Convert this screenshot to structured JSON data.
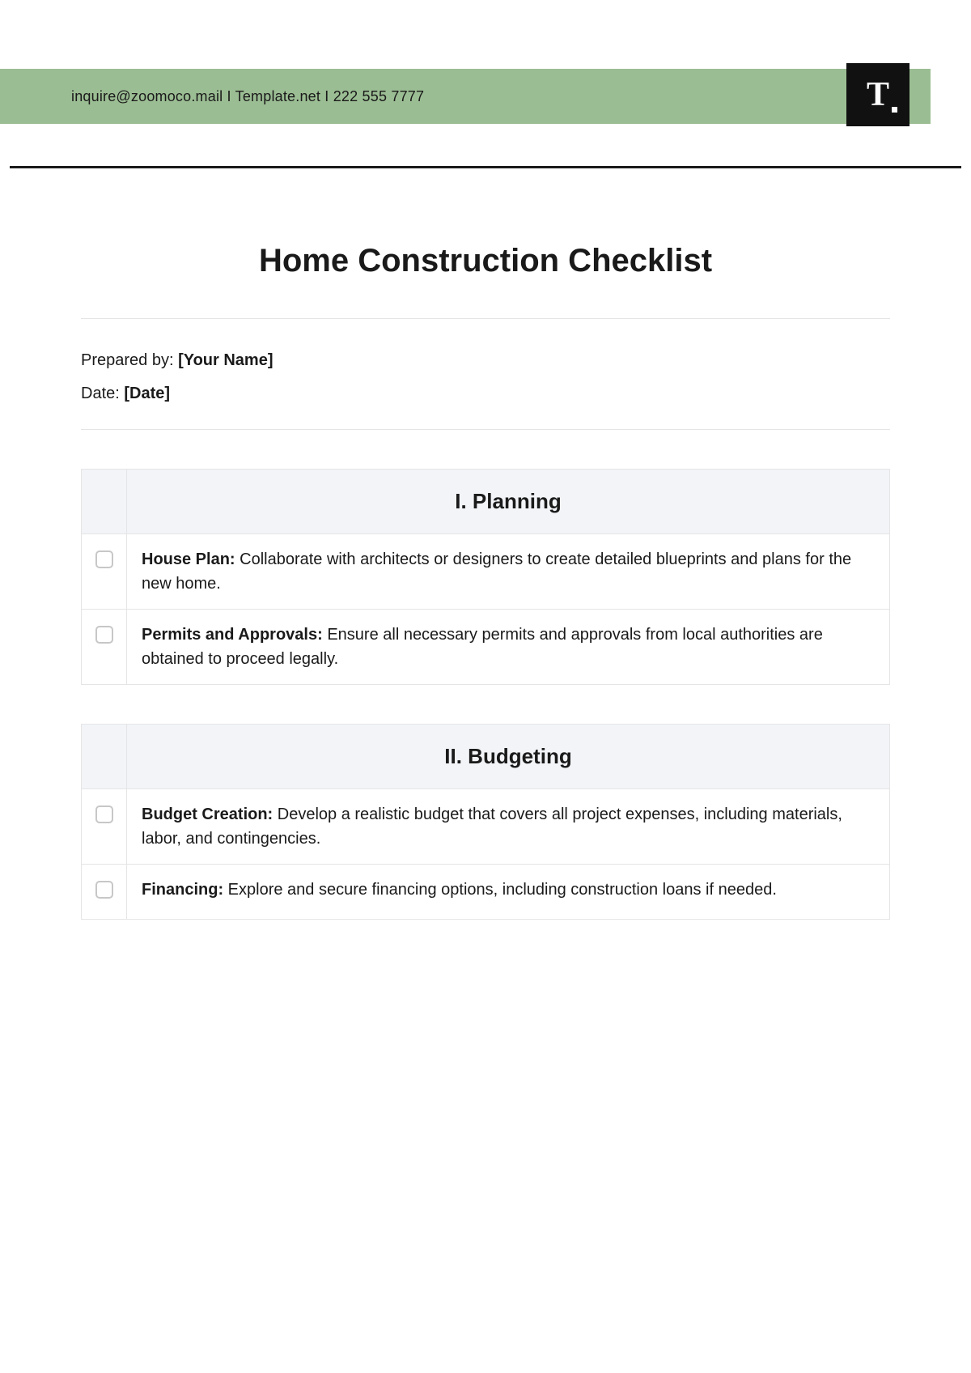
{
  "header": {
    "contact": "inquire@zoomoco.mail  I  Template.net  I  222 555 7777",
    "logo_text": "T"
  },
  "document": {
    "title": "Home Construction Checklist",
    "prepared_by_label": "Prepared by: ",
    "prepared_by_value": "[Your Name]",
    "date_label": "Date: ",
    "date_value": "[Date]"
  },
  "sections": [
    {
      "heading": "I. Planning",
      "items": [
        {
          "label": "House Plan:",
          "text": " Collaborate with architects or designers to create detailed blueprints and plans for the new home."
        },
        {
          "label": "Permits and Approvals:",
          "text": " Ensure all necessary permits and approvals from local authorities are obtained to proceed legally."
        }
      ]
    },
    {
      "heading": "II. Budgeting",
      "items": [
        {
          "label": "Budget Creation:",
          "text": " Develop a realistic budget that covers all project expenses, including materials, labor, and contingencies."
        },
        {
          "label": "Financing:",
          "text": " Explore and secure financing options, including construction loans if needed."
        }
      ]
    }
  ]
}
